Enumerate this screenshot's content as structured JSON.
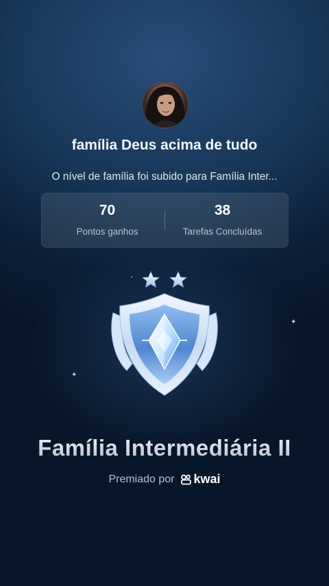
{
  "profile": {
    "avatar_icon": "profile-photo",
    "name": "família Deus acima de tudo"
  },
  "message": "O nível de família foi subido para Família Inter...",
  "stats": [
    {
      "value": "70",
      "label": "Pontos ganhos"
    },
    {
      "value": "38",
      "label": "Tarefas Concluídas"
    }
  ],
  "badge": {
    "icon": "shield-badge-icon",
    "stars": 2,
    "level_name": "Família Intermediária II"
  },
  "footer": {
    "awarded_by": "Premiado por",
    "brand": "kwai"
  },
  "colors": {
    "background_top": "#284d78",
    "background_bottom": "#081629",
    "badge_blue": "#5d95dc"
  }
}
